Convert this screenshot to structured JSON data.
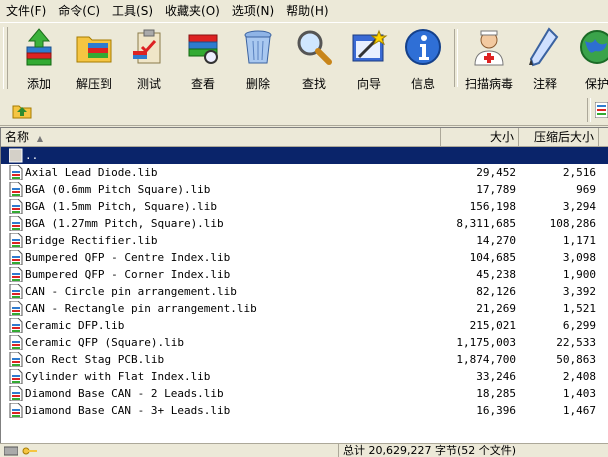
{
  "menu": {
    "items": [
      "文件(F)",
      "命令(C)",
      "工具(S)",
      "收藏夹(O)",
      "选项(N)",
      "帮助(H)"
    ]
  },
  "toolbar": {
    "add": "添加",
    "extract_to": "解压到",
    "test": "测试",
    "view": "查看",
    "delete": "删除",
    "find": "查找",
    "wizard": "向导",
    "info": "信息",
    "scan_virus": "扫描病毒",
    "comment": "注释",
    "protect": "保护"
  },
  "list": {
    "headers": {
      "name": "名称",
      "size": "大小",
      "packed": "压缩后大小"
    },
    "parent_row": "..",
    "files": [
      {
        "name": "Axial Lead Diode.lib",
        "size": "29,452",
        "packed": "2,516"
      },
      {
        "name": "BGA (0.6mm Pitch Square).lib",
        "size": "17,789",
        "packed": "969"
      },
      {
        "name": "BGA (1.5mm Pitch, Square).lib",
        "size": "156,198",
        "packed": "3,294"
      },
      {
        "name": "BGA (1.27mm Pitch, Square).lib",
        "size": "8,311,685",
        "packed": "108,286"
      },
      {
        "name": "Bridge Rectifier.lib",
        "size": "14,270",
        "packed": "1,171"
      },
      {
        "name": "Bumpered QFP - Centre Index.lib",
        "size": "104,685",
        "packed": "3,098"
      },
      {
        "name": "Bumpered QFP - Corner Index.lib",
        "size": "45,238",
        "packed": "1,900"
      },
      {
        "name": "CAN - Circle pin arrangement.lib",
        "size": "82,126",
        "packed": "3,392"
      },
      {
        "name": "CAN - Rectangle pin arrangement.lib",
        "size": "21,269",
        "packed": "1,521"
      },
      {
        "name": "Ceramic DFP.lib",
        "size": "215,021",
        "packed": "6,299"
      },
      {
        "name": "Ceramic QFP (Square).lib",
        "size": "1,175,003",
        "packed": "22,533"
      },
      {
        "name": "Con Rect Stag PCB.lib",
        "size": "1,874,700",
        "packed": "50,863"
      },
      {
        "name": "Cylinder with Flat Index.lib",
        "size": "33,246",
        "packed": "2,408"
      },
      {
        "name": "Diamond Base CAN - 2 Leads.lib",
        "size": "18,285",
        "packed": "1,403"
      },
      {
        "name": "Diamond Base CAN - 3+ Leads.lib",
        "size": "16,396",
        "packed": "1,467"
      }
    ]
  },
  "status": {
    "total": "总计 20,629,227 字节(52 个文件)"
  },
  "colors": {
    "selected_row": "#0a246a",
    "chrome": "#ece9d8"
  }
}
